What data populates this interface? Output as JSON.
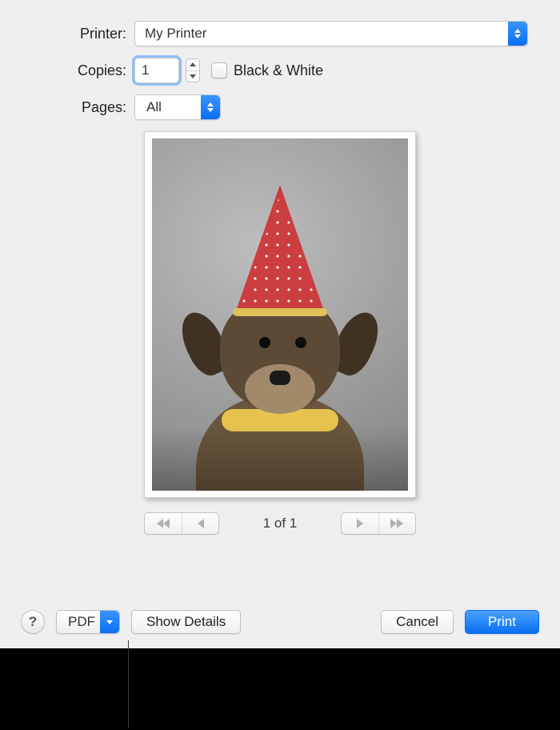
{
  "form": {
    "printer_label": "Printer:",
    "printer_value": "My Printer",
    "copies_label": "Copies:",
    "copies_value": "1",
    "bw_label": "Black & White",
    "pages_label": "Pages:",
    "pages_value": "All"
  },
  "preview": {
    "page_counter": "1 of 1"
  },
  "bottom": {
    "help": "?",
    "pdf": "PDF",
    "show_details": "Show Details",
    "cancel": "Cancel",
    "print": "Print"
  },
  "colors": {
    "accent": "#0a6ff3"
  }
}
